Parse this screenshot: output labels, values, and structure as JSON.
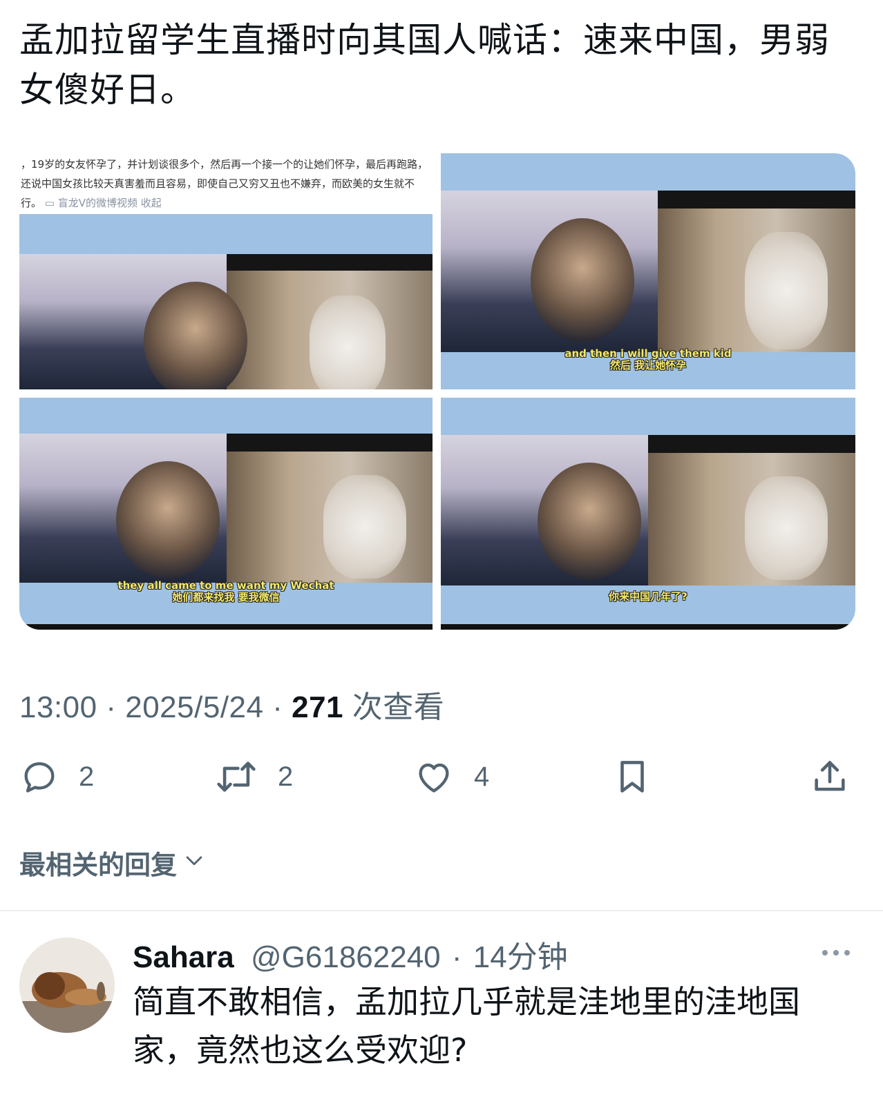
{
  "post": {
    "text": "孟加拉留学生直播时向其国人喊话：速来中国，男弱女傻好日。"
  },
  "media": {
    "caption": "，19岁的女友怀孕了，并计划谈很多个，然后再一个接一个的让她们怀孕，最后再跑路，还说中国女孩比较天真害羞而且容易，即使自己又穷又丑也不嫌弃，而欧美的女生就不行。",
    "caption_link": "▭ 盲龙V的微博视频 收起",
    "subtitle_2_en": "and then i will give them kid",
    "subtitle_2_zh": "然后 我让她怀孕",
    "subtitle_3_en": "they all came to me want my Wechat",
    "subtitle_3_zh": "她们都来找我 要我微信",
    "subtitle_4_zh": "你来中国几年了?"
  },
  "meta": {
    "time": "13:00",
    "date": "2025/5/24",
    "views": "271",
    "views_label": "次查看",
    "sep": "·"
  },
  "actions": {
    "replies": "2",
    "reposts": "2",
    "likes": "4"
  },
  "replies_section": {
    "sort_label": "最相关的回复"
  },
  "reply": {
    "name": "Sahara",
    "handle": "@G61862240",
    "time": "14分钟",
    "text": "简直不敢相信，孟加拉几乎就是洼地里的洼地国家，竟然也这么受欢迎?"
  }
}
